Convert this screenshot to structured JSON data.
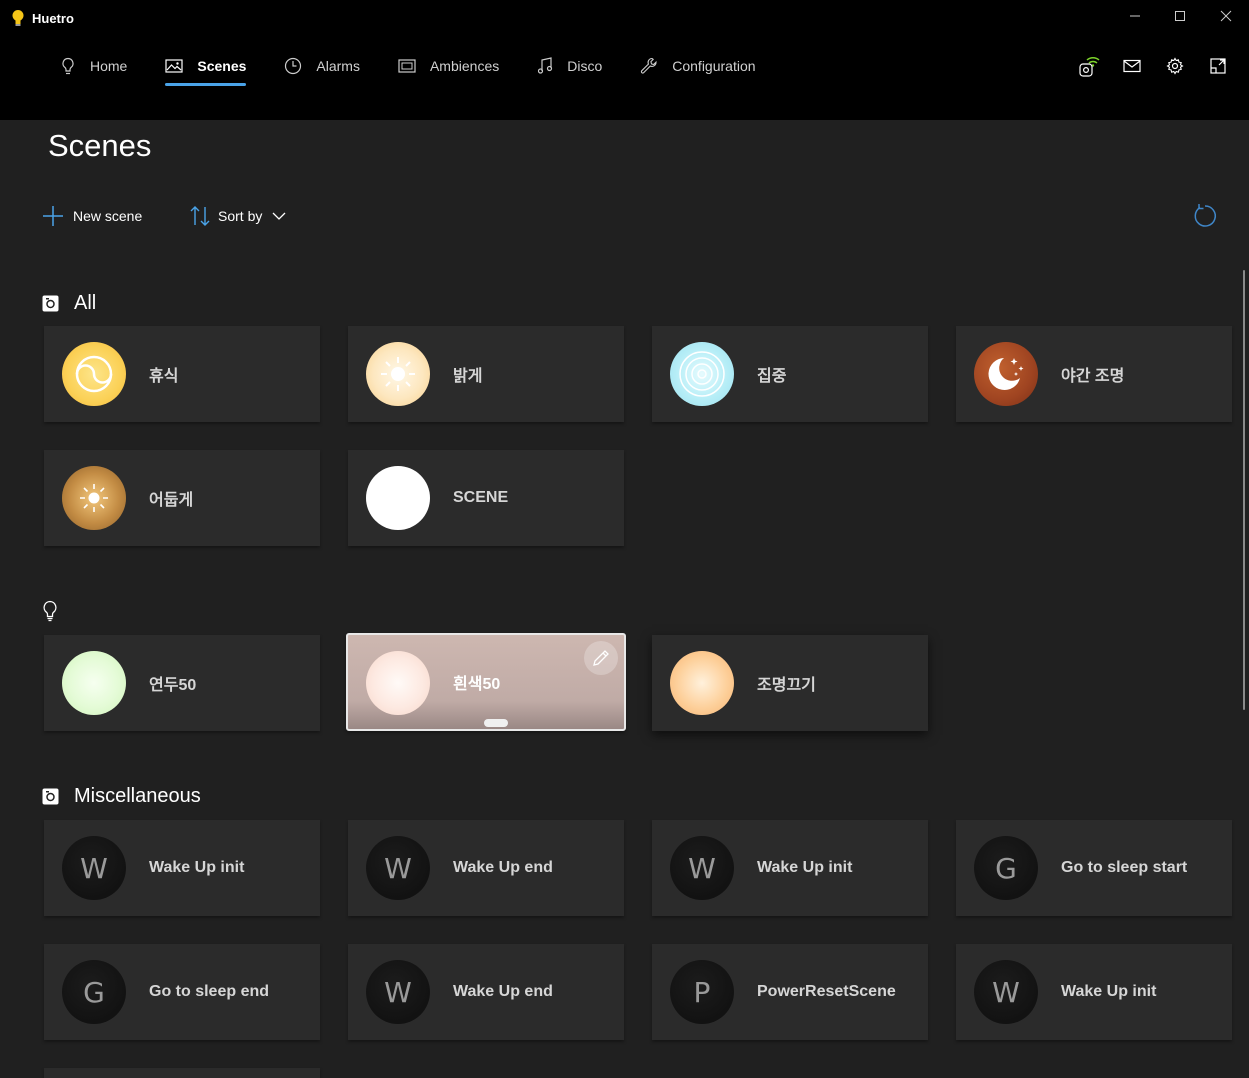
{
  "app": {
    "title": "Huetro"
  },
  "nav": {
    "items": [
      {
        "label": "Home",
        "icon": "lightbulb-icon"
      },
      {
        "label": "Scenes",
        "icon": "image-icon",
        "active": true
      },
      {
        "label": "Alarms",
        "icon": "clock-icon"
      },
      {
        "label": "Ambiences",
        "icon": "slideshow-icon"
      },
      {
        "label": "Disco",
        "icon": "music-note-icon"
      },
      {
        "label": "Configuration",
        "icon": "wrench-icon"
      }
    ]
  },
  "toolbar_icons": [
    "bridge-connected-icon",
    "mail-icon",
    "settings-icon",
    "widget-icon"
  ],
  "page": {
    "title": "Scenes"
  },
  "commands": {
    "new_scene": "New scene",
    "sort_by": "Sort by"
  },
  "sections": {
    "all": {
      "title": "All",
      "cards": [
        {
          "label": "휴식",
          "icon": "yin-yang-icon"
        },
        {
          "label": "밝게",
          "icon": "sun-icon"
        },
        {
          "label": "집중",
          "icon": "target-icon"
        },
        {
          "label": "야간 조명",
          "icon": "moon-stars-icon"
        },
        {
          "label": "어둡게",
          "icon": "dim-sun-icon"
        },
        {
          "label": "SCENE",
          "icon": ""
        }
      ]
    },
    "lights": {
      "title": "",
      "cards": [
        {
          "label": "연두50"
        },
        {
          "label": "흰색50",
          "selected": true
        },
        {
          "label": "조명끄기"
        }
      ]
    },
    "misc": {
      "title": "Miscellaneous",
      "cards": [
        {
          "letter": "W",
          "label": "Wake Up init"
        },
        {
          "letter": "W",
          "label": "Wake Up end"
        },
        {
          "letter": "W",
          "label": "Wake Up init"
        },
        {
          "letter": "G",
          "label": "Go to sleep start"
        },
        {
          "letter": "G",
          "label": "Go to sleep end"
        },
        {
          "letter": "W",
          "label": "Wake Up end"
        },
        {
          "letter": "P",
          "label": "PowerResetScene"
        },
        {
          "letter": "W",
          "label": "Wake Up init"
        }
      ]
    }
  },
  "colors": {
    "accent": "#4aa3e8",
    "background": "#202020",
    "card": "#2b2b2b",
    "titlebar": "#000000"
  }
}
